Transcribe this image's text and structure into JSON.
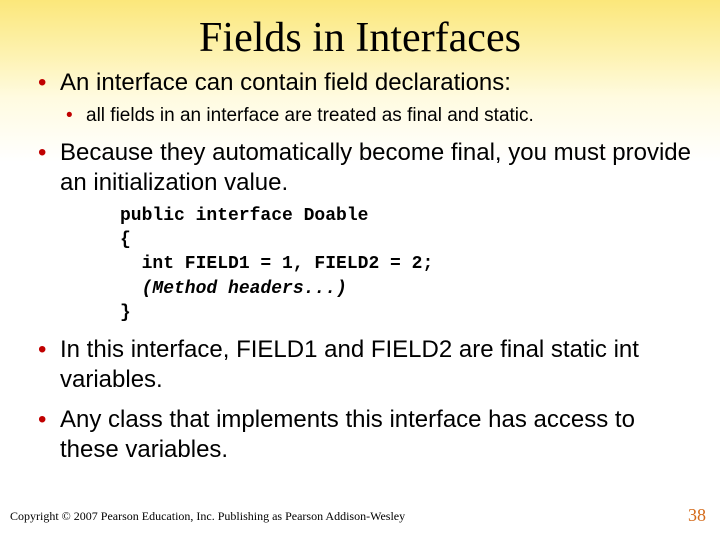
{
  "title": "Fields in Interfaces",
  "bullets": {
    "b1": "An interface can contain field declarations:",
    "b1_1": "all fields in an interface are treated as final and static.",
    "b2": "Because they automatically become final, you must provide an initialization value.",
    "b3": "In this interface, FIELD1 and FIELD2 are final static int variables.",
    "b4": "Any class that implements this interface has access to these variables."
  },
  "code": {
    "l1": "public interface Doable",
    "l2": "{",
    "l3": "  int FIELD1 = 1, FIELD2 = 2;",
    "l4": "  (Method headers...)",
    "l5": "}"
  },
  "footer": "Copyright © 2007 Pearson Education, Inc. Publishing as Pearson Addison-Wesley",
  "page": "38"
}
